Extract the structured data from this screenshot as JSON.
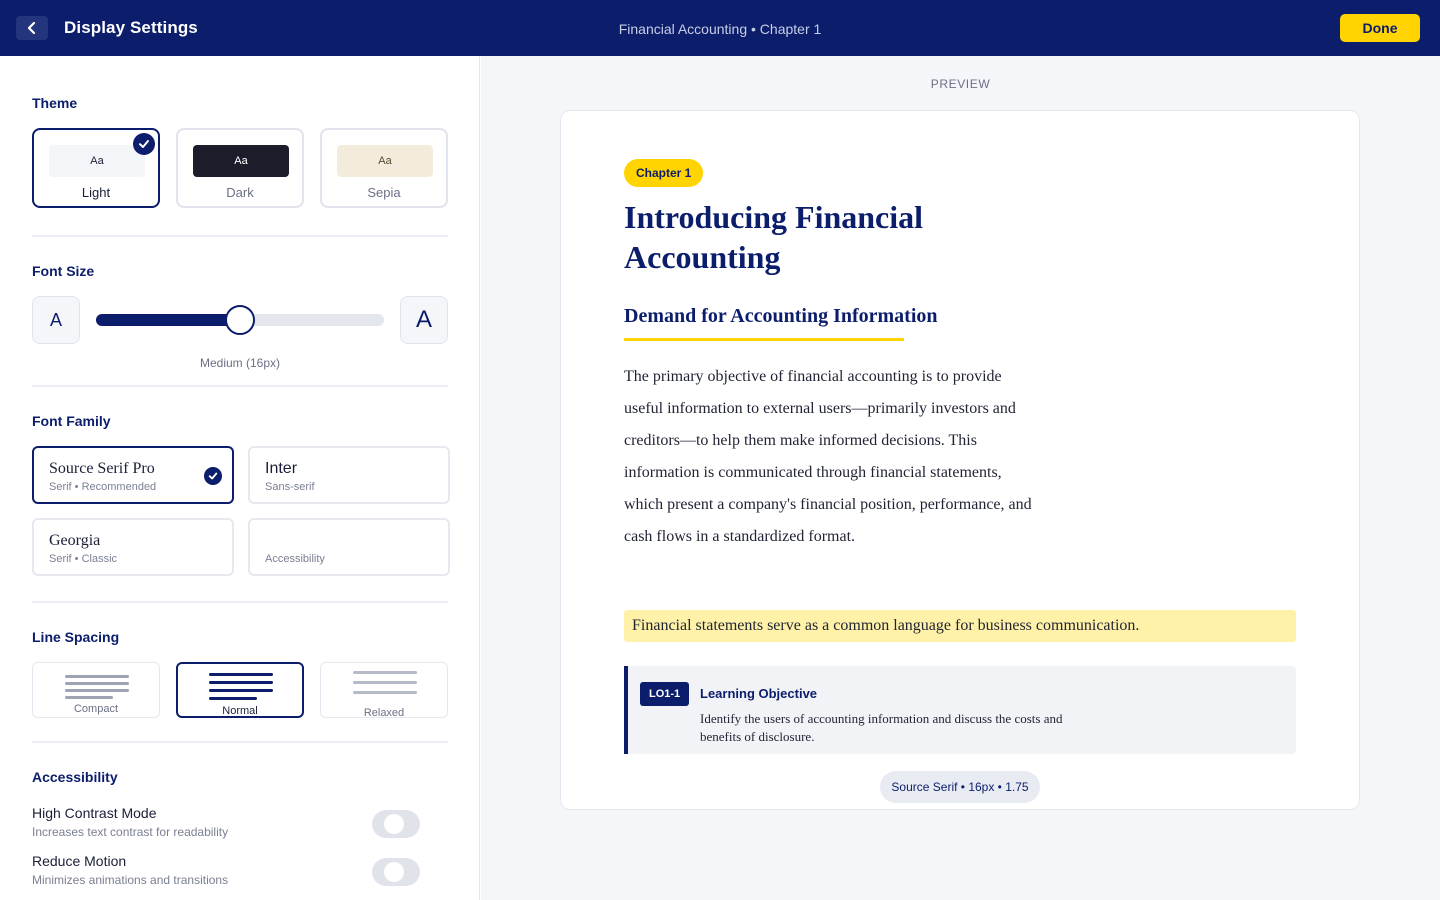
{
  "header": {
    "title": "Display Settings",
    "breadcrumb": "Financial Accounting • Chapter 1",
    "done_label": "Done"
  },
  "sidebar": {
    "theme": {
      "title": "Theme",
      "options": [
        {
          "label": "Light",
          "swatch_text": "Aa",
          "selected": true
        },
        {
          "label": "Dark",
          "swatch_text": "Aa",
          "selected": false
        },
        {
          "label": "Sepia",
          "swatch_text": "Aa",
          "selected": false
        }
      ]
    },
    "font_size": {
      "title": "Font Size",
      "small_glyph": "A",
      "large_glyph": "A",
      "value_label": "Medium (16px)",
      "slider_level": 0.5
    },
    "font_family": {
      "title": "Font Family",
      "options": [
        {
          "name": "Source Serif Pro",
          "sub": "Serif • Recommended",
          "selected": true
        },
        {
          "name": "Inter",
          "sub": "Sans-serif",
          "selected": false
        },
        {
          "name": "Georgia",
          "sub": "Serif • Classic",
          "selected": false
        },
        {
          "name": "",
          "sub": "Accessibility",
          "selected": false
        }
      ]
    },
    "line_spacing": {
      "title": "Line Spacing",
      "options": [
        {
          "label": "Compact",
          "selected": false
        },
        {
          "label": "Normal",
          "selected": true
        },
        {
          "label": "Relaxed",
          "selected": false
        }
      ]
    },
    "accessibility": {
      "title": "Accessibility",
      "items": [
        {
          "title": "High Contrast Mode",
          "sub": "Increases text contrast for readability",
          "enabled": false
        },
        {
          "title": "Reduce Motion",
          "sub": "Minimizes animations and transitions",
          "enabled": false
        }
      ]
    }
  },
  "preview": {
    "caption": "PREVIEW",
    "chapter_badge": "Chapter 1",
    "title": "Introducing Financial Accounting",
    "section_heading": "Demand for Accounting Information",
    "body": "The primary objective of financial accounting is to provide useful information to external users—primarily investors and creditors—to help them make informed decisions. This information is communicated through financial statements, which present a company's financial position, performance, and cash flows in a standardized format.",
    "highlight": "Financial statements serve as a common language for business communication.",
    "learning_objective": {
      "tag": "LO1-1",
      "title": "Learning Objective",
      "text": "Identify the users of accounting information and discuss the costs and benefits of disclosure."
    },
    "meta": "Source Serif • 16px • 1.75"
  },
  "colors": {
    "brand_navy": "#0b1d6b",
    "accent_yellow": "#ffd400",
    "highlight_yellow": "#fff2a8"
  }
}
